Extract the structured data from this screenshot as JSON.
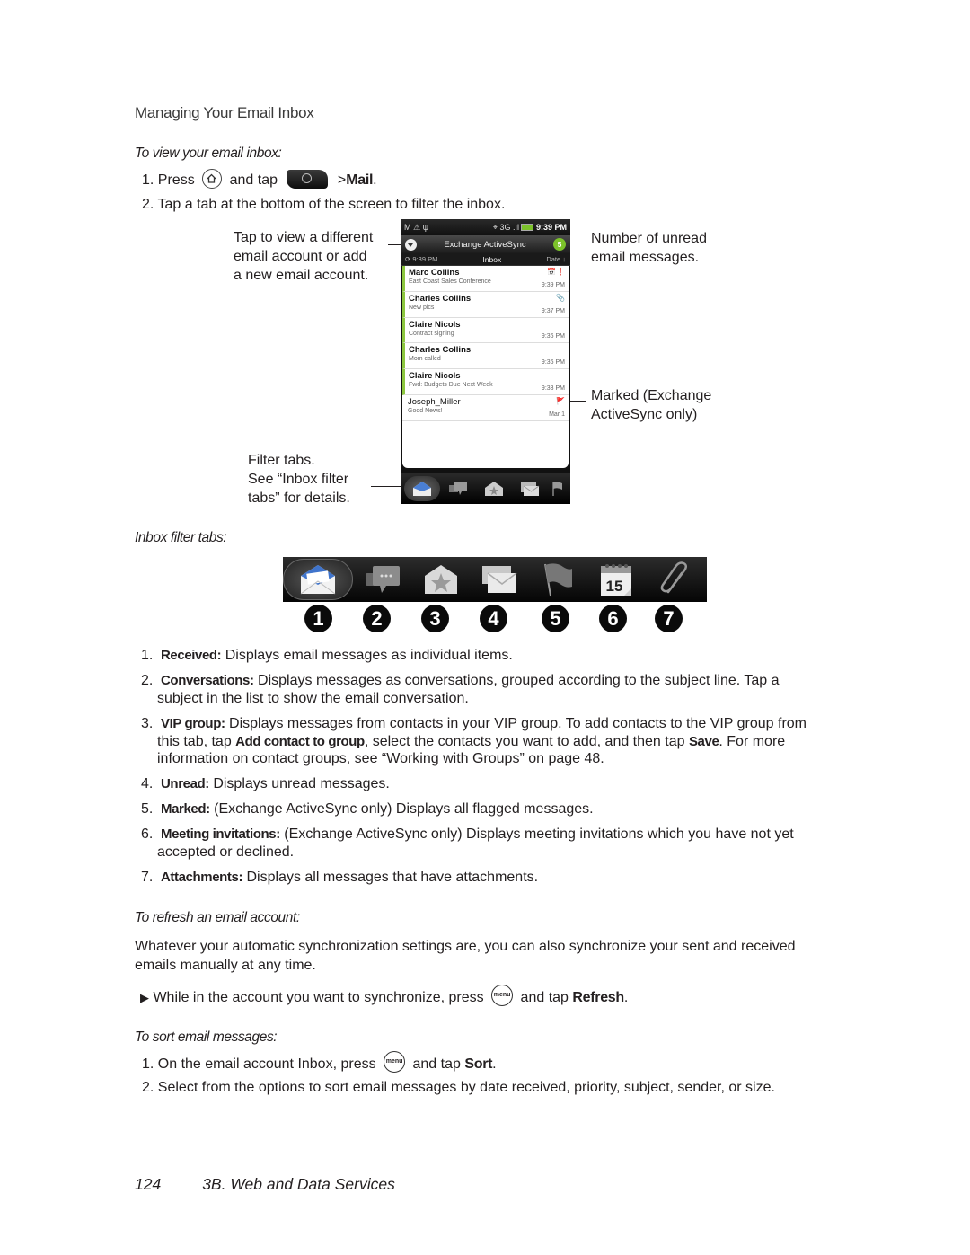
{
  "section_title": "Managing Your Email Inbox",
  "view_inbox": {
    "heading": "To view your email inbox:",
    "step1": {
      "num": "1.",
      "press": "Press",
      "and_tap": "and tap",
      "sep": ">",
      "target": "Mail",
      "end": "."
    },
    "step2": {
      "num": "2.",
      "text": "Tap a tab at the bottom of the screen to filter the inbox."
    }
  },
  "callouts": {
    "account": [
      "Tap to view a different",
      "email account or add",
      "a new email account."
    ],
    "unread": [
      "Number of unread",
      "email messages."
    ],
    "marked": [
      "Marked (Exchange",
      "ActiveSync only)"
    ],
    "filter": [
      "Filter tabs.",
      "See “Inbox filter",
      "tabs” for details."
    ]
  },
  "phone": {
    "status_time": "9:39 PM",
    "status_icons": "M ⚠ ψ",
    "status_right": "⌖ 3G .ıl",
    "account_name": "Exchange ActiveSync",
    "unread_count": "5",
    "sync_time": "9:39 PM",
    "folder": "Inbox",
    "sort": "Date ↓",
    "messages": [
      {
        "sender": "Marc Collins",
        "subject": "East Coast Sales Conference",
        "time": "9:39 PM",
        "unread": true,
        "marker": "📅❗"
      },
      {
        "sender": "Charles Collins",
        "subject": "New pics",
        "time": "9:37 PM",
        "unread": true,
        "marker": "📎"
      },
      {
        "sender": "Claire Nicols",
        "subject": "Contract signing",
        "time": "9:36 PM",
        "unread": true,
        "marker": ""
      },
      {
        "sender": "Charles Collins",
        "subject": "Mom called",
        "time": "9:36 PM",
        "unread": true,
        "marker": ""
      },
      {
        "sender": "Claire Nicols",
        "subject": "Fwd: Budgets Due Next Week",
        "time": "9:33 PM",
        "unread": true,
        "marker": ""
      },
      {
        "sender": "Joseph_Miller",
        "subject": "Good News!",
        "time": "Mar 1",
        "unread": false,
        "marker": "🚩"
      }
    ]
  },
  "filter_tabs": {
    "heading": "Inbox filter tabs:",
    "numbers": [
      "1",
      "2",
      "3",
      "4",
      "5",
      "6",
      "7"
    ],
    "calendar_day": "15",
    "items": [
      {
        "num": "1.",
        "label": "Received:",
        "text": " Displays email messages as individual items."
      },
      {
        "num": "2.",
        "label": "Conversations:",
        "text": " Displays messages as conversations, grouped according to the subject line. Tap a",
        "cont": "subject in the list to show the email conversation."
      },
      {
        "num": "3.",
        "label": "VIP group:",
        "text": " Displays messages from contacts in your VIP group. To add contacts to the VIP group from",
        "cont_pre": "this tab, tap ",
        "cont_bold": "Add contact to group",
        "cont_mid": ", select the contacts you want to add, and then tap ",
        "cont_bold2": "Save",
        "cont_post": ". For more",
        "cont2": "information on contact groups, see “Working with Groups” on page 48."
      },
      {
        "num": "4.",
        "label": "Unread:",
        "text": " Displays unread messages."
      },
      {
        "num": "5.",
        "label": "Marked:",
        "text": " (Exchange ActiveSync only) Displays all flagged messages."
      },
      {
        "num": "6.",
        "label": "Meeting invitations:",
        "text": " (Exchange ActiveSync only) Displays meeting invitations which you have not yet",
        "cont": "accepted or declined."
      },
      {
        "num": "7.",
        "label": "Attachments:",
        "text": " Displays all messages that have attachments."
      }
    ]
  },
  "refresh": {
    "heading": "To refresh an email account:",
    "para1": "Whatever your automatic synchronization settings are, you can also synchronize your sent and received",
    "para2": "emails manually at any time.",
    "bullet_pre": "While in the account you want to synchronize, press",
    "bullet_mid": "and tap",
    "bullet_bold": "Refresh",
    "bullet_end": "."
  },
  "sort": {
    "heading": "To sort email messages:",
    "step1_num": "1.",
    "step1_pre": "On the email account Inbox, press",
    "step1_mid": "and tap",
    "step1_bold": "Sort",
    "step1_end": ".",
    "step2_num": "2.",
    "step2": "Select from the options to sort email messages by date received, priority, subject, sender, or size."
  },
  "menu_key_label": "menu",
  "footer": {
    "page": "124",
    "section": "3B. Web and Data Services"
  }
}
